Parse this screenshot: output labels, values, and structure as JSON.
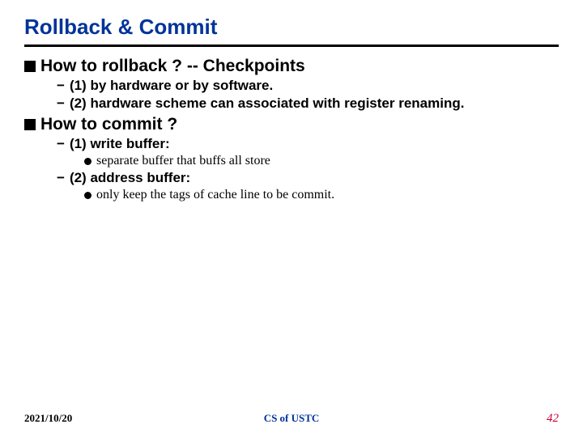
{
  "title": "Rollback & Commit",
  "sections": {
    "s1": {
      "heading": "How to rollback ? -- Checkpoints",
      "i1": "(1) by hardware or by software.",
      "i2": "(2) hardware scheme can associated with register renaming."
    },
    "s2": {
      "heading": "How to commit ?",
      "i1": "(1) write buffer:",
      "i1a": "separate buffer that buffs all store",
      "i2": "(2) address buffer:",
      "i2a": "only keep the tags of cache line to be commit."
    }
  },
  "footer": {
    "date": "2021/10/20",
    "org": "CS of USTC",
    "page": "42"
  }
}
